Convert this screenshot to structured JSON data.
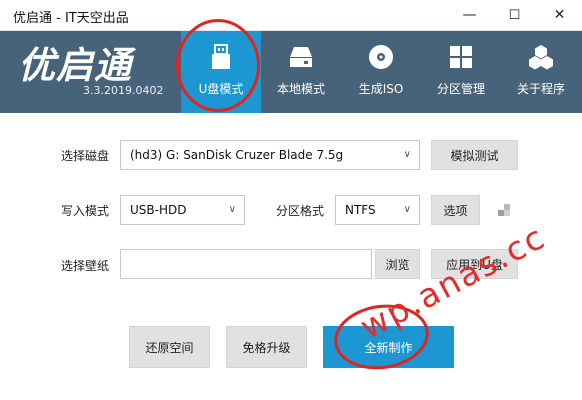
{
  "window": {
    "title": "优启通 - IT天空出品",
    "minimize": "—",
    "maximize": "☐",
    "close": "✕"
  },
  "header": {
    "logo": "优启通",
    "version": "3.3.2019.0402",
    "bg_color": "#46637a",
    "accent_color": "#1c97d2"
  },
  "nav": {
    "tabs": [
      {
        "label": "U盘模式",
        "icon": "usb-drive-icon",
        "active": true
      },
      {
        "label": "本地模式",
        "icon": "hard-disk-icon",
        "active": false
      },
      {
        "label": "生成ISO",
        "icon": "disc-icon",
        "active": false
      },
      {
        "label": "分区管理",
        "icon": "partition-grid-icon",
        "active": false
      },
      {
        "label": "关于程序",
        "icon": "cubes-icon",
        "active": false
      }
    ]
  },
  "form": {
    "disk_label": "选择磁盘",
    "disk_value": "(hd3) G: SanDisk Cruzer Blade 7.5g",
    "simulate_button": "模拟测试",
    "write_mode_label": "写入模式",
    "write_mode_value": "USB-HDD",
    "partition_format_label": "分区格式",
    "partition_format_value": "NTFS",
    "options_button": "选项",
    "wallpaper_label": "选择壁纸",
    "wallpaper_value": "",
    "browse_button": "浏览",
    "apply_button": "应用到U盘"
  },
  "actions": {
    "restore_button": "还原空间",
    "upgrade_button": "免格升级",
    "create_button": "全新制作"
  },
  "annotations": {
    "watermark": "wp.anas.cc",
    "highlight_color": "#e0241e"
  }
}
